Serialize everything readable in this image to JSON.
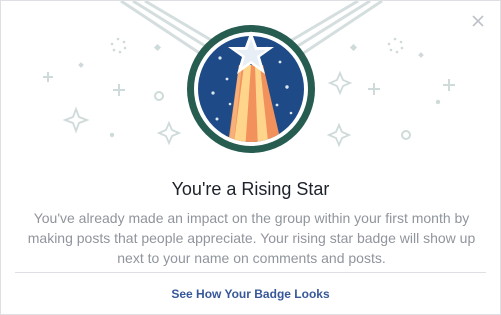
{
  "dialog": {
    "title": "You're a Rising Star",
    "body": "You've already made an impact on the group within your first month by making posts that people appreciate. Your rising star badge will show up next to your name on comments and posts.",
    "cta_label": "See How Your Badge Looks"
  },
  "icons": {
    "close": "close-icon",
    "badge": "rising-star-badge-icon"
  },
  "colors": {
    "badge_navy": "#1e4b87",
    "badge_ring": "#275c50",
    "ribbon": "#d5dede",
    "sparkle": "#cfdada",
    "beam_orange": "#f2915c",
    "beam_yellow": "#ffd58b",
    "link": "#365899"
  }
}
